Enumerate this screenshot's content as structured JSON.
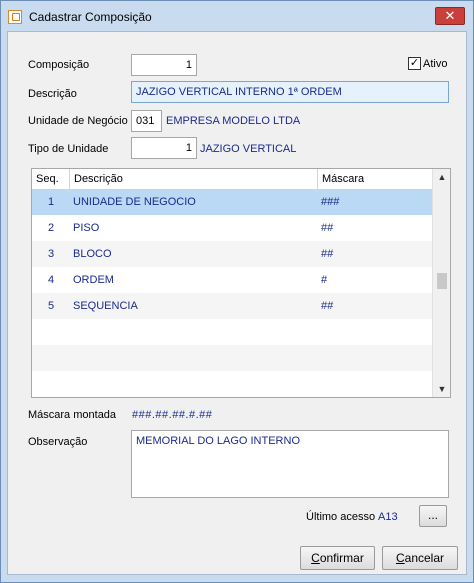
{
  "window": {
    "title": "Cadastrar Composição",
    "close_label": "✕"
  },
  "form": {
    "composicao_label": "Composição",
    "composicao_value": "1",
    "ativo_label": "Ativo",
    "ativo_checked": true,
    "descricao_label": "Descrição",
    "descricao_value": "JAZIGO VERTICAL INTERNO 1ª ORDEM",
    "unidade_negocio_label": "Unidade de Negócio",
    "unidade_negocio_code": "031",
    "unidade_negocio_name": "EMPRESA MODELO LTDA",
    "tipo_unidade_label": "Tipo de Unidade",
    "tipo_unidade_code": "1",
    "tipo_unidade_name": "JAZIGO VERTICAL"
  },
  "grid": {
    "headers": [
      "Seq.",
      "Descrição",
      "Máscara"
    ],
    "rows": [
      {
        "seq": "1",
        "descricao": "UNIDADE DE NEGOCIO",
        "mascara": "###"
      },
      {
        "seq": "2",
        "descricao": "PISO",
        "mascara": "##"
      },
      {
        "seq": "3",
        "descricao": "BLOCO",
        "mascara": "##"
      },
      {
        "seq": "4",
        "descricao": "ORDEM",
        "mascara": "#"
      },
      {
        "seq": "5",
        "descricao": "SEQUENCIA",
        "mascara": "##"
      }
    ],
    "selected_row": 1
  },
  "mascara_montada": {
    "label": "Máscara montada",
    "value": "###.##.##.#.##"
  },
  "observacao": {
    "label": "Observação",
    "value": "MEMORIAL DO LAGO INTERNO"
  },
  "ultimo_acesso": {
    "label": "Último acesso",
    "value": "A13",
    "button_label": "..."
  },
  "buttons": {
    "confirmar_first": "C",
    "confirmar_rest": "onfirmar",
    "cancelar_first": "C",
    "cancelar_rest": "ancelar"
  },
  "icons": {
    "app": "app-icon",
    "close": "close-icon",
    "scroll_up": "chevron-up-icon",
    "scroll_down": "chevron-down-icon"
  }
}
